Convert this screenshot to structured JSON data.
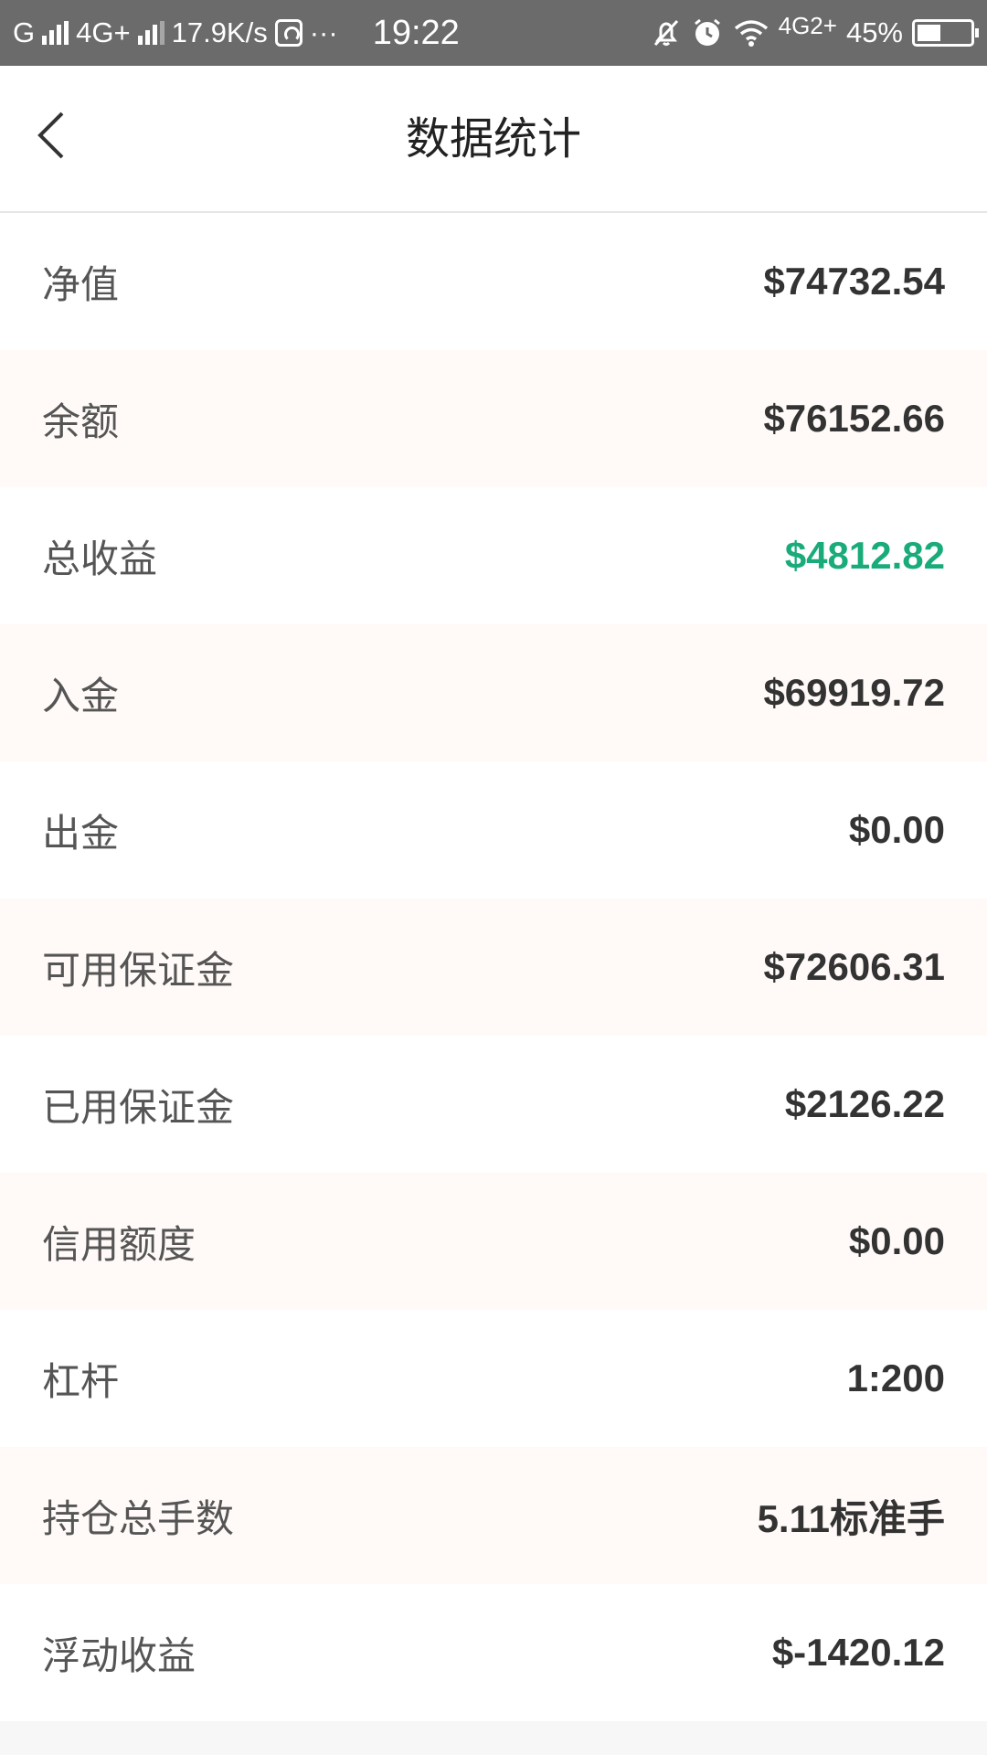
{
  "status_bar": {
    "carrier1": "G",
    "network": "4G+",
    "speed": "17.9K/s",
    "dots": "···",
    "time": "19:22",
    "network2": "4G",
    "network2_sub": "2+",
    "battery": "45%"
  },
  "header": {
    "title": "数据统计",
    "back_icon": "chevron-left-icon"
  },
  "stats": [
    {
      "label": "净值",
      "value": "$74732.54"
    },
    {
      "label": "余额",
      "value": "$76152.66"
    },
    {
      "label": "总收益",
      "value": "$4812.82",
      "highlight_color": "#1aab7a"
    },
    {
      "label": "入金",
      "value": "$69919.72"
    },
    {
      "label": "出金",
      "value": "$0.00"
    },
    {
      "label": "可用保证金",
      "value": "$72606.31"
    },
    {
      "label": "已用保证金",
      "value": "$2126.22"
    },
    {
      "label": "信用额度",
      "value": "$0.00"
    },
    {
      "label": "杠杆",
      "value": "1:200"
    },
    {
      "label": "持仓总手数",
      "value": "5.11标准手"
    },
    {
      "label": "浮动收益",
      "value": "$-1420.12"
    }
  ],
  "colors": {
    "status_bar_bg": "#6b6b6b",
    "row_alt_bg": "#fffaf7",
    "positive": "#1aab7a"
  }
}
